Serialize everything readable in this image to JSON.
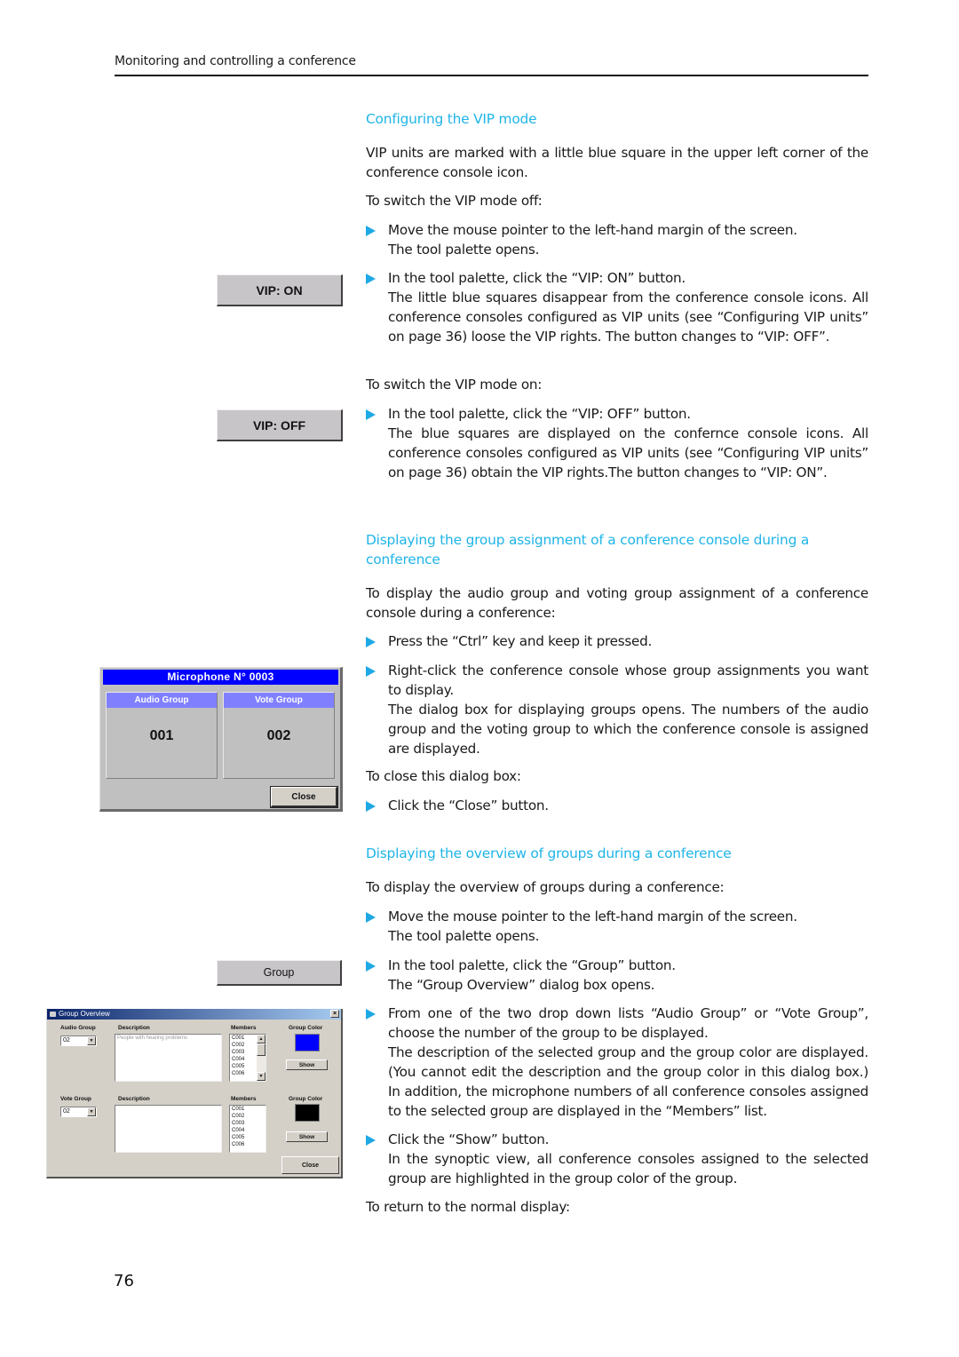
{
  "header": {
    "running_title": "Monitoring and controlling a conference"
  },
  "page_number": "76",
  "colors": {
    "heading": "#1fb4e8",
    "bullet": "#1fa9e4",
    "mic_title_bar": "#0000ff",
    "mic_panel_header": "#8080ff",
    "audio_group_color": "#0000ff",
    "vote_group_color": "#000000"
  },
  "sections": {
    "vip": {
      "heading": "Configuring the VIP mode",
      "intro": "VIP units are marked with a little blue square in the upper left corner of the conference console icon.",
      "switch_off_label": "To switch the VIP mode off:",
      "step1": [
        "Move the mouse pointer to the left-hand margin of the screen.",
        "The tool palette opens."
      ],
      "step2": [
        "In the tool palette, click the “VIP: ON” button.",
        "The little blue squares disappear from the conference console icons. All conference consoles configured as VIP units (see “Configuring VIP units” on page 36) loose the VIP rights. The button changes to “VIP: OFF”."
      ],
      "switch_on_label": "To switch the VIP mode on:",
      "step3": [
        "In the tool palette, click the “VIP: OFF” button.",
        "The blue squares are displayed on the confernce console icons. All conference consoles configured as VIP units (see “Configuring VIP units” on page 36) obtain the VIP rights.The button changes to “VIP: ON”."
      ]
    },
    "group_assignment": {
      "heading": "Displaying the group assignment of a conference console during a conference",
      "intro": "To display the audio group and voting group assignment of a conference console during a conference:",
      "step1": [
        "Press the “Ctrl” key and keep it pressed."
      ],
      "step2": [
        "Right-click the conference console whose group assignments you want to display.",
        "The dialog box for displaying groups opens. The numbers of the audio group and the voting group to which the conference console is assigned are displayed."
      ],
      "close_label": "To close this dialog box:",
      "step3": [
        "Click the “Close” button."
      ]
    },
    "group_overview": {
      "heading": "Displaying the overview of groups during a conference",
      "intro": "To display the overview of groups during a conference:",
      "step1": [
        "Move the mouse pointer to the left-hand margin of the screen.",
        "The tool palette opens."
      ],
      "step2": [
        "In the tool palette, click the “Group” button.",
        "The “Group Overview” dialog box opens."
      ],
      "step3": [
        "From one of the two drop down lists “Audio Group” or “Vote Group”, choose the number of the group to be displayed.",
        "The description of the selected group and the group color are displayed. (You cannot edit the description and the group color in this dialog box.) In addition, the microphone numbers of all conference consoles assigned to the selected group are displayed in the “Members” list."
      ],
      "step4": [
        "Click the “Show” button.",
        "In the synoptic view, all conference consoles assigned to the selected group are highlighted in the group color of the group."
      ],
      "return_label": "To return to the normal display:"
    }
  },
  "figures": {
    "vip_on_button": "VIP: ON",
    "vip_off_button": "VIP: OFF",
    "group_button": "Group",
    "mic_dialog": {
      "title": "Microphone N°   0003",
      "audio_group_label": "Audio Group",
      "audio_group_value": "001",
      "vote_group_label": "Vote Group",
      "vote_group_value": "002",
      "close_button": "Close"
    },
    "group_overview_dialog": {
      "title": "Group Overview",
      "close_x": "×",
      "audio": {
        "group_label": "Audio Group",
        "group_value": "02",
        "description_label": "Description",
        "description_value": "People with hearing problems",
        "members_label": "Members",
        "members": [
          "C001",
          "C002",
          "C003",
          "C004",
          "C005",
          "C006"
        ],
        "color_label": "Group Color",
        "show_button": "Show"
      },
      "vote": {
        "group_label": "Vote Group",
        "group_value": "02",
        "description_label": "Description",
        "description_value": "",
        "members_label": "Members",
        "members": [
          "C001",
          "C002",
          "C003",
          "C004",
          "C005",
          "C006"
        ],
        "color_label": "Group Color",
        "show_button": "Show"
      },
      "close_button": "Close"
    }
  }
}
